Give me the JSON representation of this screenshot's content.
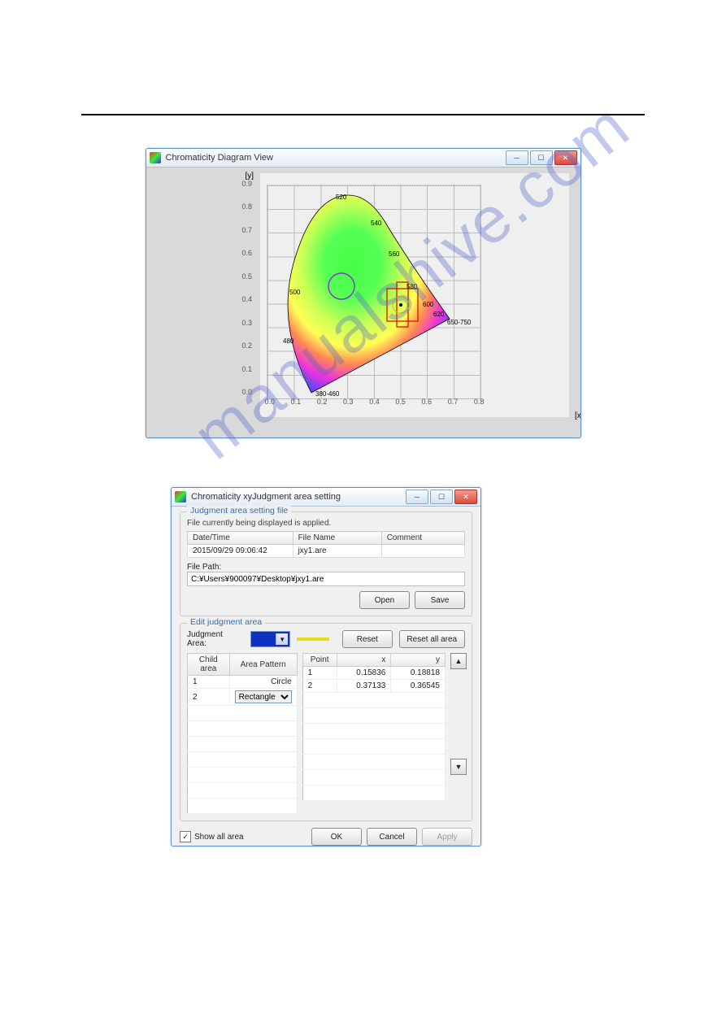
{
  "watermark": "manualshive.com",
  "chroma_window": {
    "title": "Chromaticity Diagram View",
    "y_axis_label": "[y]",
    "x_axis_label": "[x]",
    "y_ticks": [
      "0.0",
      "0.1",
      "0.2",
      "0.3",
      "0.4",
      "0.5",
      "0.6",
      "0.7",
      "0.8",
      "0.9"
    ],
    "x_ticks": [
      "0.0",
      "0.1",
      "0.2",
      "0.3",
      "0.4",
      "0.5",
      "0.6",
      "0.7",
      "0.8"
    ],
    "wavelength_labels": [
      "380-460",
      "480",
      "500",
      "520",
      "540",
      "560",
      "580",
      "600",
      "620",
      "650-750"
    ]
  },
  "chart_data": {
    "type": "scatter",
    "title": "Chromaticity Diagram View",
    "xlabel": "[x]",
    "ylabel": "[y]",
    "xlim": [
      0.0,
      0.8
    ],
    "ylim": [
      0.0,
      0.9
    ],
    "overlays": [
      {
        "name": "purple-circle",
        "shape": "circle",
        "cx": 0.28,
        "cy": 0.47,
        "r": 0.05
      },
      {
        "name": "red-rectangle-large",
        "shape": "rect",
        "x0": 0.45,
        "y0": 0.32,
        "x1": 0.56,
        "y1": 0.46
      },
      {
        "name": "red-rectangle-narrow",
        "shape": "rect",
        "x0": 0.49,
        "y0": 0.3,
        "x1": 0.53,
        "y1": 0.49
      },
      {
        "name": "yellow-circle",
        "shape": "circle",
        "cx": 0.5,
        "cy": 0.4,
        "r": 0.03
      }
    ],
    "measurement_point": {
      "x": 0.5,
      "y": 0.4
    }
  },
  "dialog": {
    "title": "Chromaticity xyJudgment area setting",
    "group1": {
      "title": "Judgment area setting file",
      "subtext": "File currently being displayed is applied.",
      "headers": {
        "datetime": "Date/Time",
        "filename": "File Name",
        "comment": "Comment"
      },
      "row": {
        "datetime": "2015/09/29 09:06:42",
        "filename": "jxy1.are",
        "comment": ""
      },
      "file_path_label": "File Path:",
      "file_path_value": "C:¥Users¥900097¥Desktop¥jxy1.are",
      "open_btn": "Open",
      "save_btn": "Save"
    },
    "group2": {
      "title": "Edit judgment area",
      "area_label": "Judgment Area:",
      "reset_btn": "Reset",
      "reset_all_btn": "Reset all area",
      "child_headers": {
        "child": "Child area",
        "pattern": "Area Pattern"
      },
      "child_rows": [
        {
          "id": "1",
          "pattern": "Circle"
        },
        {
          "id": "2",
          "pattern": "Rectangle"
        }
      ],
      "point_headers": {
        "point": "Point",
        "x": "x",
        "y": "y"
      },
      "point_rows": [
        {
          "id": "1",
          "x": "0.15836",
          "y": "0.18818"
        },
        {
          "id": "2",
          "x": "0.37133",
          "y": "0.36545"
        }
      ]
    },
    "show_all_label": "Show all area",
    "ok_btn": "OK",
    "cancel_btn": "Cancel",
    "apply_btn": "Apply"
  }
}
